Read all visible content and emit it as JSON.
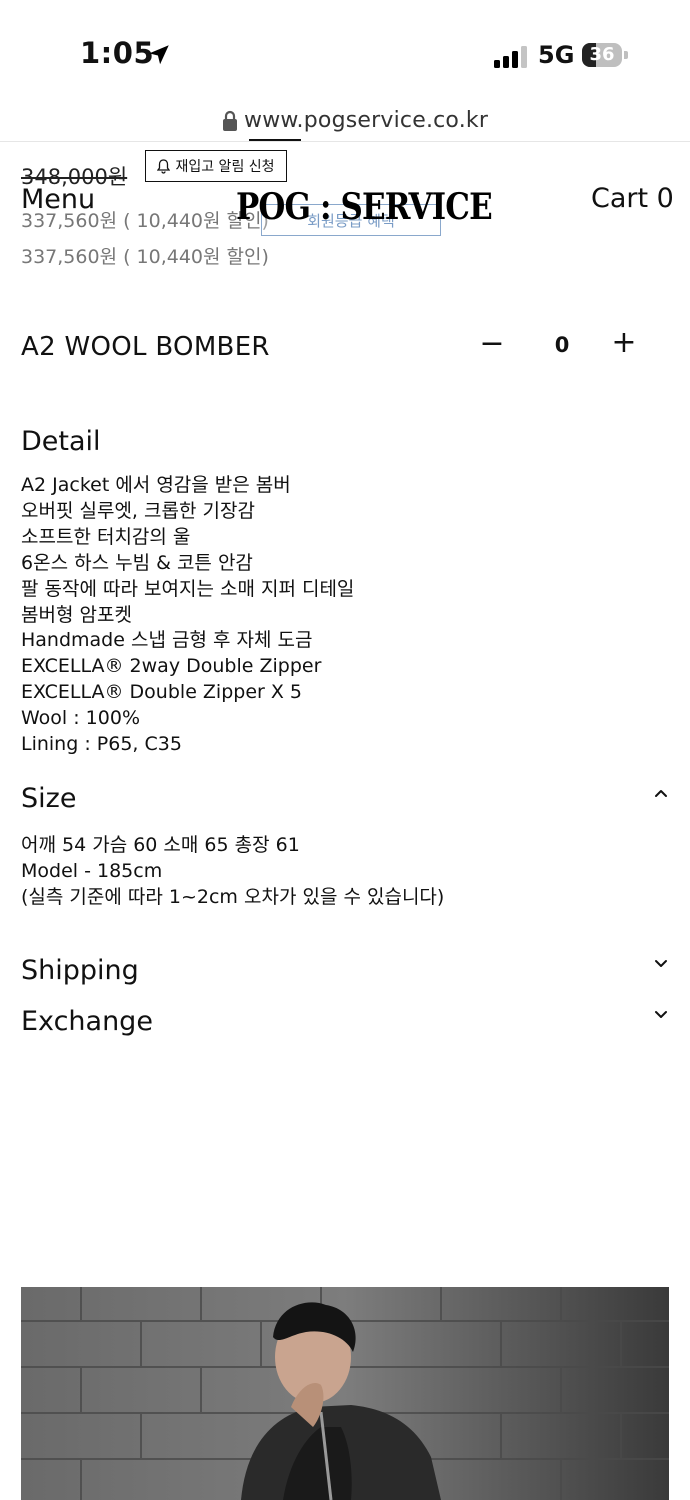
{
  "status_bar": {
    "time": "1:05",
    "network": "5G",
    "battery": "36",
    "battery_level": 0.36,
    "icons": [
      "location-arrow-icon",
      "signal-icon",
      "battery-icon"
    ]
  },
  "browser": {
    "url": "www.pogservice.co.kr",
    "icon": "lock-icon"
  },
  "header": {
    "menu_label": "Menu",
    "logo_text": "POG : SERVICE",
    "cart_label": "Cart 0"
  },
  "pricing": {
    "original_price": "348,000원",
    "restock_label": "재입고 알림 신청",
    "sale_price_member": "337,560원 ( 10,440원 할인)",
    "member_button_label": "회원등급 혜택",
    "sale_price": "337,560원 ( 10,440원 할인)"
  },
  "product": {
    "title": "A2 WOOL BOMBER",
    "quantity": "0",
    "minus_symbol": "−",
    "plus_symbol": "+"
  },
  "detail": {
    "title": "Detail",
    "lines": [
      "A2 Jacket 에서 영감을 받은 봄버",
      "오버핏 실루엣, 크롭한 기장감",
      "소프트한 터치감의 울",
      "6온스 하스 누빔 & 코튼 안감",
      "팔 동작에 따라 보여지는 소매 지퍼 디테일",
      "봄버형 암포켓",
      "Handmade 스냅 금형 후 자체 도금",
      "EXCELLA® 2way Double Zipper",
      "EXCELLA® Double Zipper X 5",
      "Wool : 100%",
      "Lining : P65, C35"
    ]
  },
  "size": {
    "title": "Size",
    "expanded": true,
    "lines": [
      "어깨 54 가슴 60 소매 65 총장 61",
      "Model - 185cm",
      "(실측 기준에 따라 1~2cm 오차가 있을 수 있습니다)"
    ]
  },
  "shipping": {
    "title": "Shipping",
    "expanded": false
  },
  "exchange": {
    "title": "Exchange",
    "expanded": false
  },
  "colors": {
    "text": "#111111",
    "muted": "#777777",
    "member_blue": "#7a9cc6"
  }
}
